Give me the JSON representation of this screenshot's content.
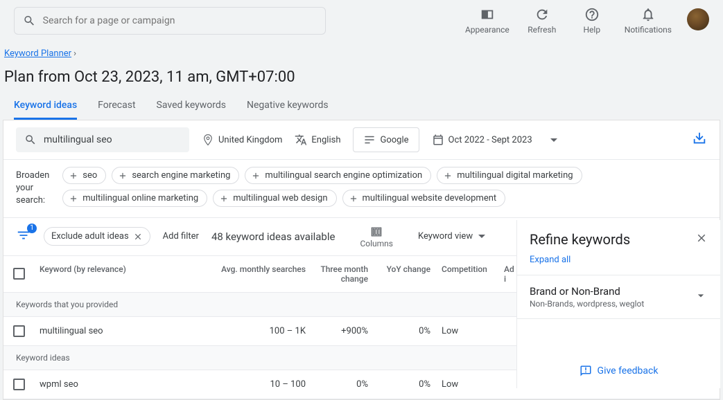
{
  "search_placeholder": "Search for a page or campaign",
  "top_actions": {
    "appearance": "Appearance",
    "refresh": "Refresh",
    "help": "Help",
    "notifications": "Notifications"
  },
  "breadcrumb": {
    "planner": "Keyword Planner"
  },
  "page_title": "Plan from Oct 23, 2023, 11 am, GMT+07:00",
  "tabs": {
    "ideas": "Keyword ideas",
    "forecast": "Forecast",
    "saved": "Saved keywords",
    "negative": "Negative keywords"
  },
  "filters": {
    "keyword": "multilingual seo",
    "location": "United Kingdom",
    "language": "English",
    "network": "Google",
    "date_range": "Oct 2022 - Sept 2023"
  },
  "broaden": {
    "label": "Broaden your search:",
    "chips": [
      "seo",
      "search engine marketing",
      "multilingual search engine optimization",
      "multilingual digital marketing",
      "multilingual online marketing",
      "multilingual web design",
      "multilingual website development"
    ]
  },
  "toolbar": {
    "filter_badge": "1",
    "exclude_pill": "Exclude adult ideas",
    "add_filter": "Add filter",
    "ideas_count": "48 keyword ideas available",
    "columns": "Columns",
    "view": "Keyword view"
  },
  "table": {
    "headers": {
      "keyword": "Keyword (by relevance)",
      "searches": "Avg. monthly searches",
      "three_month": "Three month change",
      "yoy": "YoY change",
      "competition": "Competition",
      "adi": "Ad i"
    },
    "section_provided": "Keywords that you provided",
    "section_ideas": "Keyword ideas",
    "rows": [
      {
        "kw": "multilingual seo",
        "searches": "100 – 1K",
        "three_month": "+900%",
        "yoy": "0%",
        "competition": "Low"
      },
      {
        "kw": "wpml seo",
        "searches": "10 – 100",
        "three_month": "0%",
        "yoy": "0%",
        "competition": "Low"
      }
    ]
  },
  "refine": {
    "title": "Refine keywords",
    "expand": "Expand all",
    "section_title": "Brand or Non-Brand",
    "section_sub": "Non-Brands, wordpress, weglot",
    "feedback": "Give feedback"
  }
}
